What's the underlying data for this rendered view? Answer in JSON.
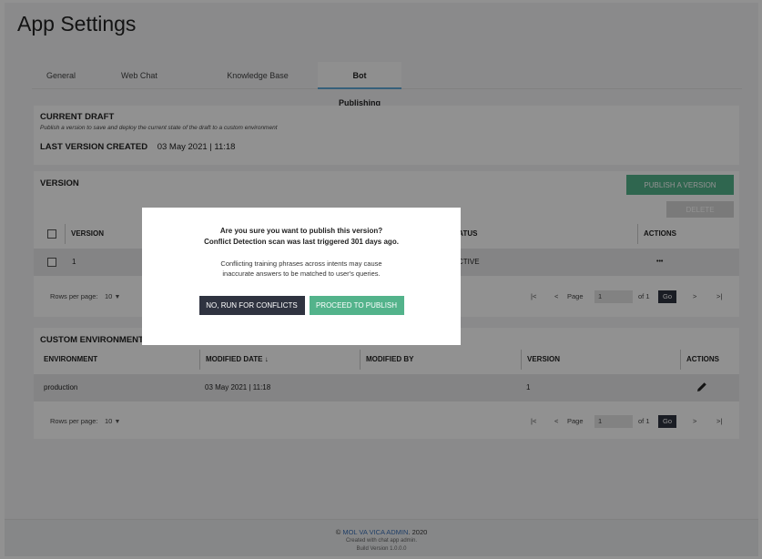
{
  "app": {
    "title": "App Settings"
  },
  "tabs": [
    {
      "label": "General"
    },
    {
      "label": "Web Chat"
    },
    {
      "label": "Knowledge Base"
    },
    {
      "label": "Bot Publishing"
    }
  ],
  "draft": {
    "title": "CURRENT DRAFT",
    "subtitle": "Publish a version to save and deploy the current state of the draft to a custom environment",
    "last_label": "LAST VERSION CREATED",
    "last_value": "03 May 2021 | 11:18"
  },
  "version": {
    "title": "VERSION",
    "publish_label": "PUBLISH A VERSION",
    "delete_label": "DELETE",
    "columns": {
      "version": "VERSION",
      "status": "TATUS",
      "actions": "ACTIONS"
    },
    "rows": [
      {
        "version": "1",
        "status": "CTIVE",
        "actions": "•••"
      }
    ],
    "pager": {
      "rows_per_page": "Rows per page:",
      "rows_value": "10",
      "page_label": "Page",
      "page_value": "1",
      "of": "of 1",
      "go": "Go",
      "first": "|<",
      "prev": "<",
      "next": ">",
      "last": ">|"
    }
  },
  "environments": {
    "title": "CUSTOM ENVIRONMENT",
    "columns": {
      "environment": "ENVIRONMENT",
      "modified_date": "MODIFIED DATE ↓",
      "modified_by": "MODIFIED BY",
      "version": "VERSION",
      "actions": "ACTIONS"
    },
    "rows": [
      {
        "environment": "production",
        "modified_date": "03 May 2021 | 11:18",
        "version": "1"
      }
    ],
    "pager": {
      "rows_per_page": "Rows per page:",
      "rows_value": "10",
      "page_label": "Page",
      "page_value": "1",
      "of": "of 1",
      "go": "Go",
      "first": "|<",
      "prev": "<",
      "next": ">",
      "last": ">|"
    }
  },
  "footer": {
    "copyright": "©",
    "link": "MOL VA VICA ADMIN",
    "year": ". 2020",
    "created": "Created with chat app admin.",
    "build": "Build Version 1.0.0.0"
  },
  "modal": {
    "question": "Are you sure you want to publish this version?",
    "scan": "Conflict Detection scan was last triggered 301 days ago.",
    "message1": "Conflicting training phrases across intents may cause",
    "message2": "inaccurate answers to be matched to user's queries.",
    "no_label": "NO, RUN FOR CONFLICTS",
    "proceed_label": "PROCEED TO PUBLISH"
  },
  "colors": {
    "accent": "#53b38b",
    "dark": "#2f3340",
    "tab_underline": "#5fa9d6"
  }
}
